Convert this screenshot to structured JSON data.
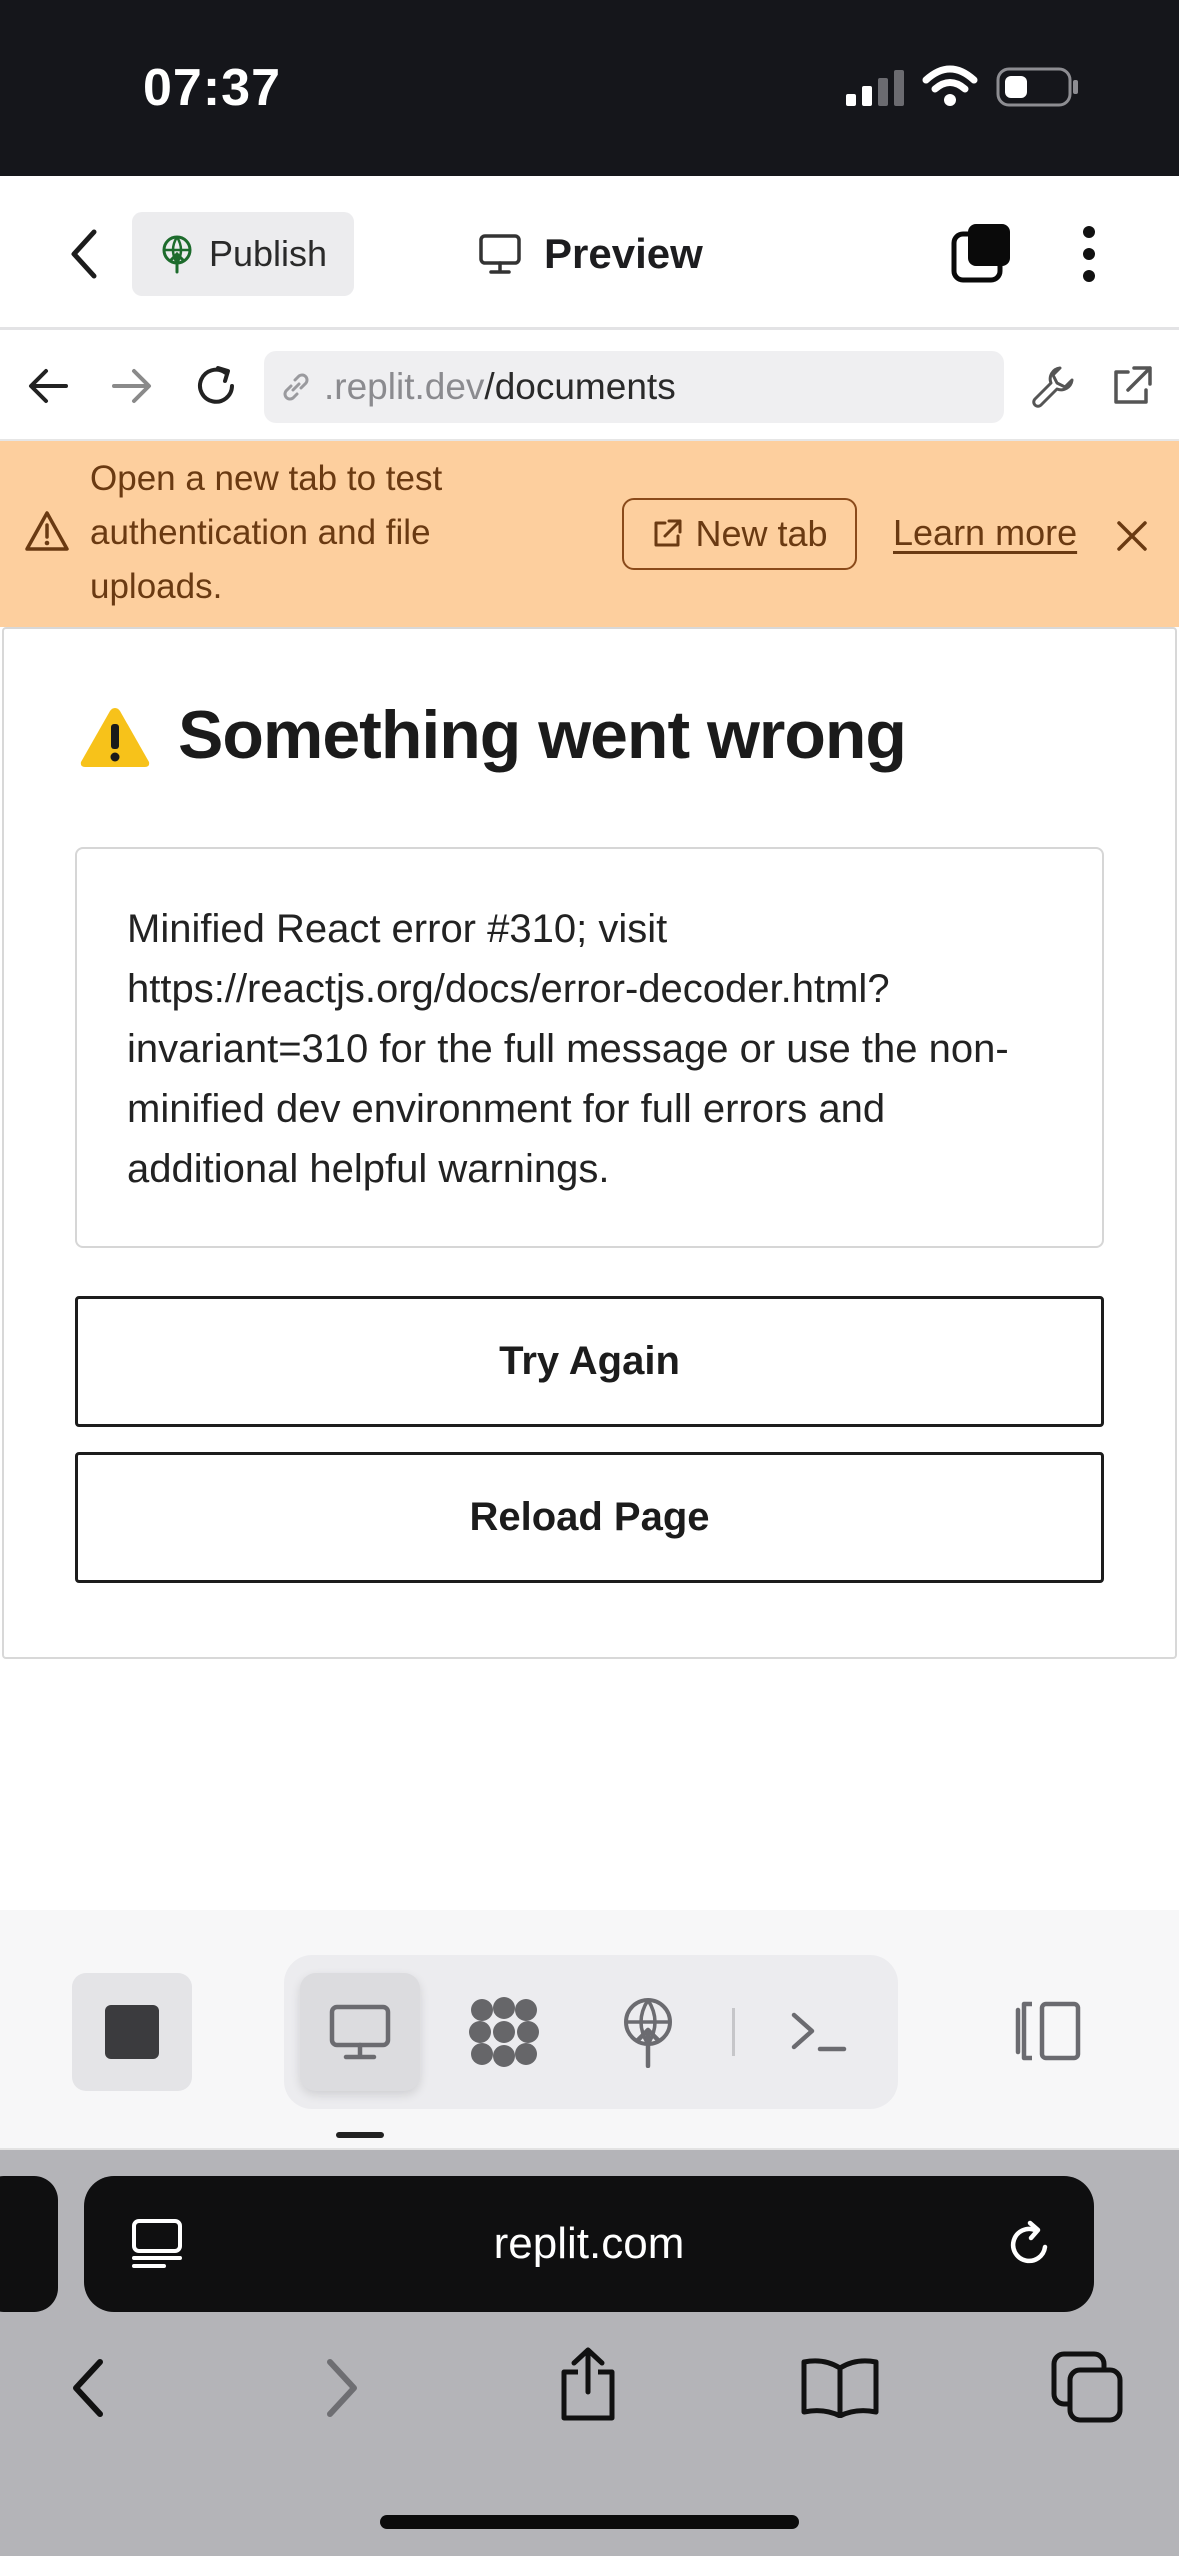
{
  "status_bar": {
    "time": "07:37"
  },
  "top_bar": {
    "publish_label": "Publish",
    "preview_label": "Preview"
  },
  "url_bar": {
    "domain": ".replit.dev",
    "path": "/documents"
  },
  "banner": {
    "message": "Open a new tab to test authentication and file uploads.",
    "new_tab_label": "New tab",
    "learn_more_label": "Learn more"
  },
  "error": {
    "title": "Something went wrong",
    "message": "Minified React error #310; visit https://reactjs.org/docs/error-decoder.html?invariant=310 for the full message or use the non-minified dev environment for full errors and additional helpful warnings.",
    "try_again_label": "Try Again",
    "reload_label": "Reload Page"
  },
  "safari": {
    "url": "replit.com"
  },
  "icons": {
    "back": "chevron-left-icon",
    "publish": "globe-upload-icon",
    "preview": "monitor-icon",
    "tabs": "stacked-squares-icon",
    "menu": "vertical-dots-icon",
    "warning": "warning-triangle-icon",
    "error": "warning-emoji-icon"
  },
  "colors": {
    "status_bar_bg": "#15161b",
    "banner_bg": "#fdcf9e",
    "banner_text": "#6a3a12",
    "safari_bg": "#b4b4b8"
  }
}
